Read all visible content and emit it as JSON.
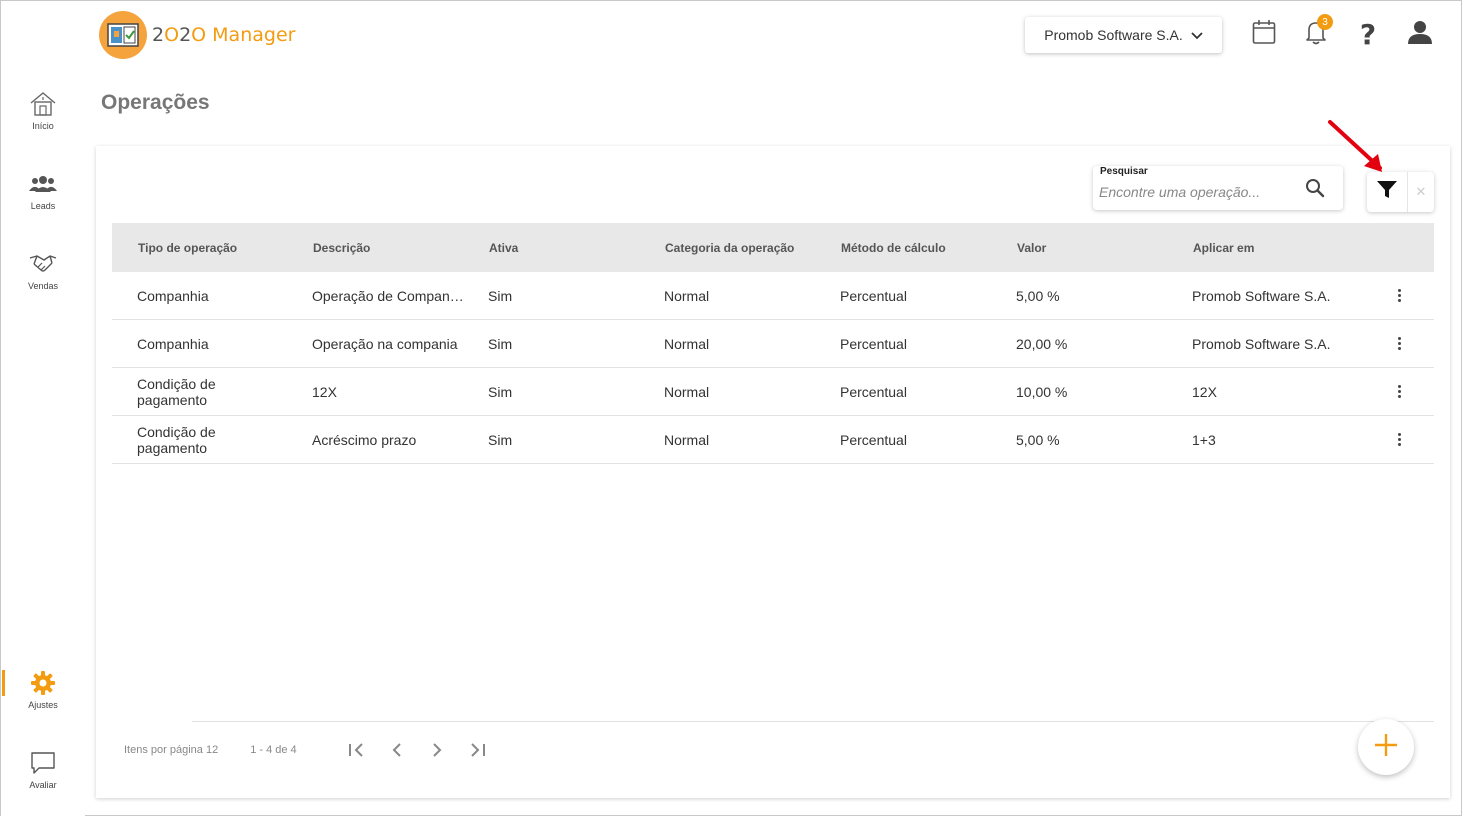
{
  "app": {
    "logo_part1": "2",
    "logo_part2": "O",
    "logo_part3": "2",
    "logo_part4": "O",
    "logo_rest": " Manager"
  },
  "sidebar": {
    "items": [
      {
        "label": "Início",
        "icon": "home-icon"
      },
      {
        "label": "Leads",
        "icon": "users-icon"
      },
      {
        "label": "Vendas",
        "icon": "handshake-icon"
      },
      {
        "label": "Ajustes",
        "icon": "gear-icon"
      },
      {
        "label": "Avaliar",
        "icon": "chat-icon"
      }
    ]
  },
  "header": {
    "company": "Promob Software S.A.",
    "notifications_count": "3"
  },
  "page": {
    "title": "Operações"
  },
  "search": {
    "label": "Pesquisar",
    "placeholder": "Encontre uma operação..."
  },
  "table": {
    "columns": [
      "Tipo de operação",
      "Descrição",
      "Ativa",
      "Categoria da operação",
      "Método de cálculo",
      "Valor",
      "Aplicar em"
    ],
    "rows": [
      [
        "Companhia",
        "Operação de Companhia",
        "Sim",
        "Normal",
        "Percentual",
        "5,00 %",
        "Promob Software S.A."
      ],
      [
        "Companhia",
        "Operação na compania",
        "Sim",
        "Normal",
        "Percentual",
        "20,00 %",
        "Promob Software S.A."
      ],
      [
        "Condição de pagamento",
        "12X",
        "Sim",
        "Normal",
        "Percentual",
        "10,00 %",
        "12X"
      ],
      [
        "Condição de pagamento",
        "Acréscimo prazo",
        "Sim",
        "Normal",
        "Percentual",
        "5,00 %",
        "1+3"
      ]
    ]
  },
  "pagination": {
    "per_page": "Itens por página 12",
    "range": "1 - 4 de 4"
  },
  "colors": {
    "accent": "#f39c12",
    "header_bg": "#e8e8e8",
    "annotation_arrow": "#e3000f"
  }
}
